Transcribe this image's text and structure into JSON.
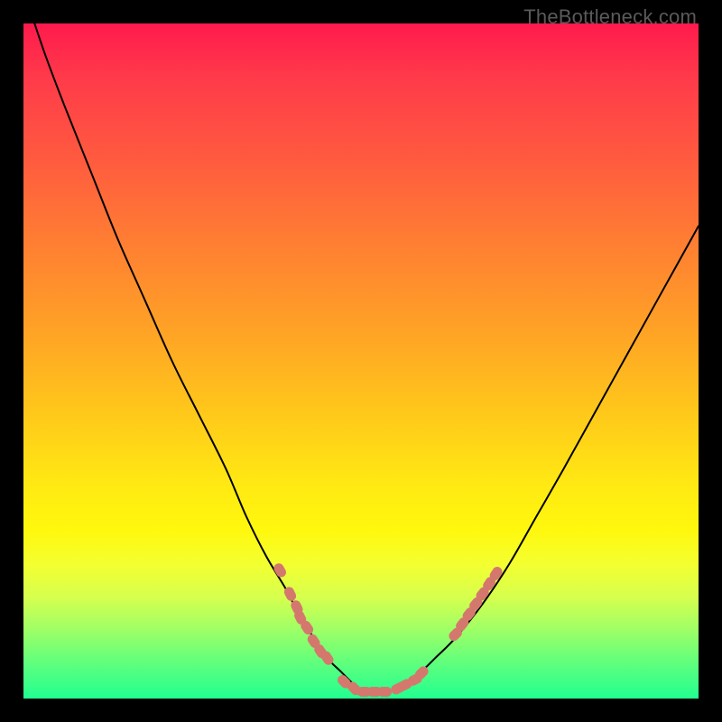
{
  "watermark": "TheBottleneck.com",
  "chart_data": {
    "type": "line",
    "title": "",
    "xlabel": "",
    "ylabel": "",
    "xlim": [
      0,
      100
    ],
    "ylim": [
      0,
      100
    ],
    "grid": false,
    "legend": false,
    "series": [
      {
        "name": "bottleneck-curve",
        "x": [
          0,
          3,
          6,
          10,
          14,
          18,
          22,
          26,
          30,
          33,
          36,
          39,
          41,
          43,
          45,
          47,
          49,
          50,
          52,
          54,
          56,
          58,
          59,
          61,
          64,
          68,
          72,
          76,
          80,
          85,
          90,
          95,
          100
        ],
        "y": [
          105,
          96,
          88,
          78,
          68,
          59,
          50,
          42,
          34,
          27,
          21,
          16,
          12,
          9,
          6,
          4,
          2,
          1,
          1,
          1,
          2,
          3,
          4,
          6,
          9,
          14,
          20,
          27,
          34,
          43,
          52,
          61,
          70
        ],
        "color": "#000000",
        "linewidth": 2
      }
    ],
    "markers": {
      "name": "bottleneck-markers",
      "color": "#d4786e",
      "shape": "rounded-capsule",
      "points": [
        {
          "x": 38,
          "y": 19
        },
        {
          "x": 39.5,
          "y": 15.5
        },
        {
          "x": 40.5,
          "y": 13.5
        },
        {
          "x": 41,
          "y": 12
        },
        {
          "x": 42,
          "y": 10.5
        },
        {
          "x": 43,
          "y": 8.5
        },
        {
          "x": 44,
          "y": 7
        },
        {
          "x": 45,
          "y": 6
        },
        {
          "x": 47.5,
          "y": 2.5
        },
        {
          "x": 49,
          "y": 1.5
        },
        {
          "x": 50.5,
          "y": 1
        },
        {
          "x": 52,
          "y": 1
        },
        {
          "x": 53.5,
          "y": 1
        },
        {
          "x": 55.5,
          "y": 1.5
        },
        {
          "x": 56.5,
          "y": 2
        },
        {
          "x": 58,
          "y": 2.8
        },
        {
          "x": 59,
          "y": 3.8
        },
        {
          "x": 64,
          "y": 9.5
        },
        {
          "x": 65,
          "y": 11
        },
        {
          "x": 66,
          "y": 12.5
        },
        {
          "x": 67,
          "y": 14
        },
        {
          "x": 68,
          "y": 15.5
        },
        {
          "x": 69,
          "y": 17
        },
        {
          "x": 70,
          "y": 18.5
        }
      ]
    }
  }
}
